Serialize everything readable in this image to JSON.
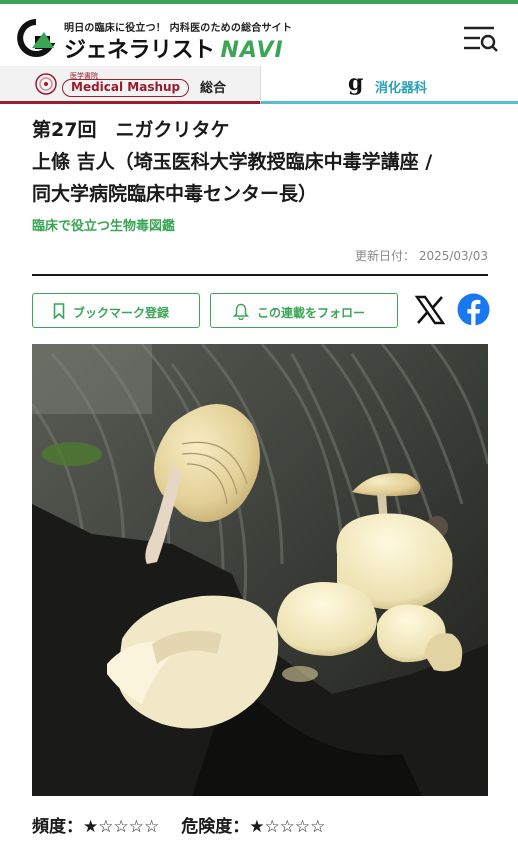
{
  "header": {
    "tagline": "明日の臨床に役立つ！ 内科医のための総合サイト",
    "logo_text": "ジェネラリスト",
    "logo_navi": "NAVI",
    "menu_icon": "menu-search-icon"
  },
  "tabs": {
    "left": {
      "badge_small": "医学書院",
      "badge": "Medical Mashup",
      "label": "総合"
    },
    "right": {
      "label": "消化器科"
    }
  },
  "article": {
    "title_line1": "第27回　ニガクリタケ",
    "title_line2": "上條 吉人（埼玉医科大学教授臨床中毒学講座 /",
    "title_line3": "同大学病院臨床中毒センター長）",
    "category": "臨床で役立つ生物毒図鑑",
    "updated_label": "更新日付：",
    "updated_date": "2025/03/03"
  },
  "actions": {
    "bookmark_label": "ブックマーク登録",
    "follow_label": "この連載をフォロー",
    "x_icon": "x-share-icon",
    "facebook_icon": "facebook-share-icon"
  },
  "rating": {
    "frequency_label": "頻度：",
    "frequency_stars": "★☆☆☆☆",
    "danger_label": "危険度：",
    "danger_stars": "★☆☆☆☆"
  },
  "colors": {
    "accent_green": "#3aa655",
    "medical_mashup_red": "#9a1d2e",
    "gastro_blue": "#2a9fb8"
  }
}
